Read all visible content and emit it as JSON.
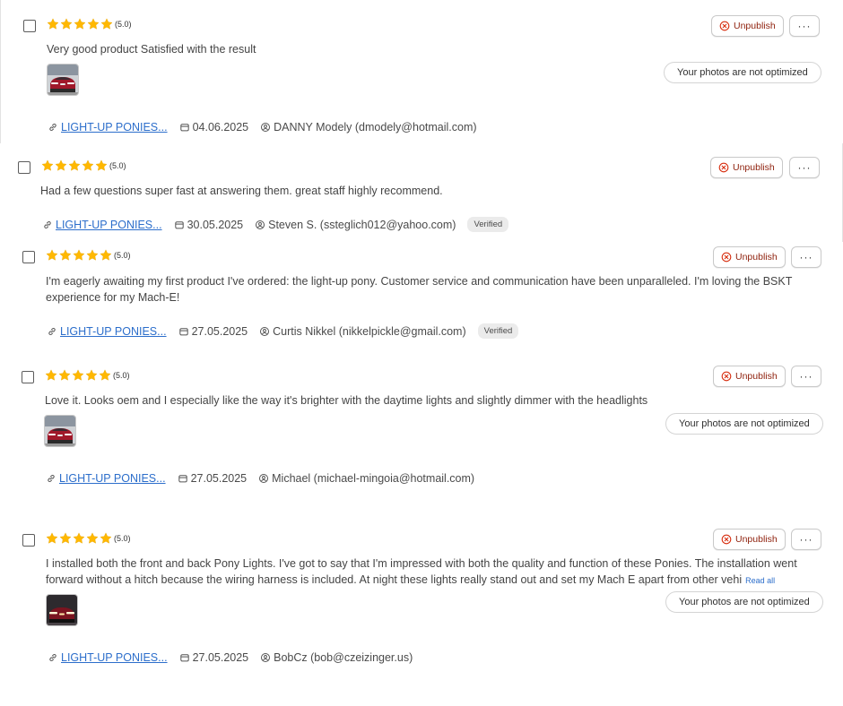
{
  "labels": {
    "unpublish": "Unpublish",
    "more": "···",
    "optimized": "Your photos are not optimized",
    "verified": "Verified",
    "read_all": "Read all"
  },
  "colors": {
    "star": "#FFB800",
    "link": "#2c6ecb",
    "unpublish_text": "#8e1f0b",
    "unpublish_icon": "#d72c0d"
  },
  "icons": {
    "star": "star-icon",
    "unpublish": "x-circle-icon",
    "more": "more-horizontal-icon",
    "product": "link-icon",
    "date": "calendar-icon",
    "customer": "profile-icon"
  },
  "reviews": [
    {
      "rating": "(5.0)",
      "stars": 5,
      "text": "Very good product Satisfied with the result",
      "product": "LIGHT-UP PONIES...",
      "date": "04.06.2025",
      "customer": "DANNY Modely (dmodely@hotmail.com)",
      "has_photo": true
    },
    {
      "rating": "(5.0)",
      "stars": 5,
      "text": "Had a few questions super fast at answering them. great staff highly recommend.",
      "product": "LIGHT-UP PONIES...",
      "date": "30.05.2025",
      "customer": "Steven S. (ssteglich012@yahoo.com)",
      "verified": true
    },
    {
      "rating": "(5.0)",
      "stars": 5,
      "text": "I'm eagerly awaiting my first product I've ordered: the light-up pony. Customer service and communication have been unparalleled. I'm loving the BSKT experience for my Mach-E!",
      "product": "LIGHT-UP PONIES...",
      "date": "27.05.2025",
      "customer": "Curtis Nikkel (nikkelpickle@gmail.com)",
      "verified": true
    },
    {
      "rating": "(5.0)",
      "stars": 5,
      "text": "Love it. Looks oem and I especially like the way it's brighter with the daytime lights and slightly dimmer with the headlights",
      "product": "LIGHT-UP PONIES...",
      "date": "27.05.2025",
      "customer": "Michael (michael-mingoia@hotmail.com)",
      "has_photo": true
    },
    {
      "rating": "(5.0)",
      "stars": 5,
      "text": "I installed both the front and back Pony Lights. I've got to say that I'm impressed with both the quality and function of these Ponies. The installation went forward without a hitch because the wiring harness is included. At night these lights really stand out and set my Mach E apart from other vehi",
      "product": "LIGHT-UP PONIES...",
      "date": "27.05.2025",
      "customer": "BobCz (bob@czeizinger.us)",
      "has_photo": true,
      "truncated": true
    }
  ]
}
